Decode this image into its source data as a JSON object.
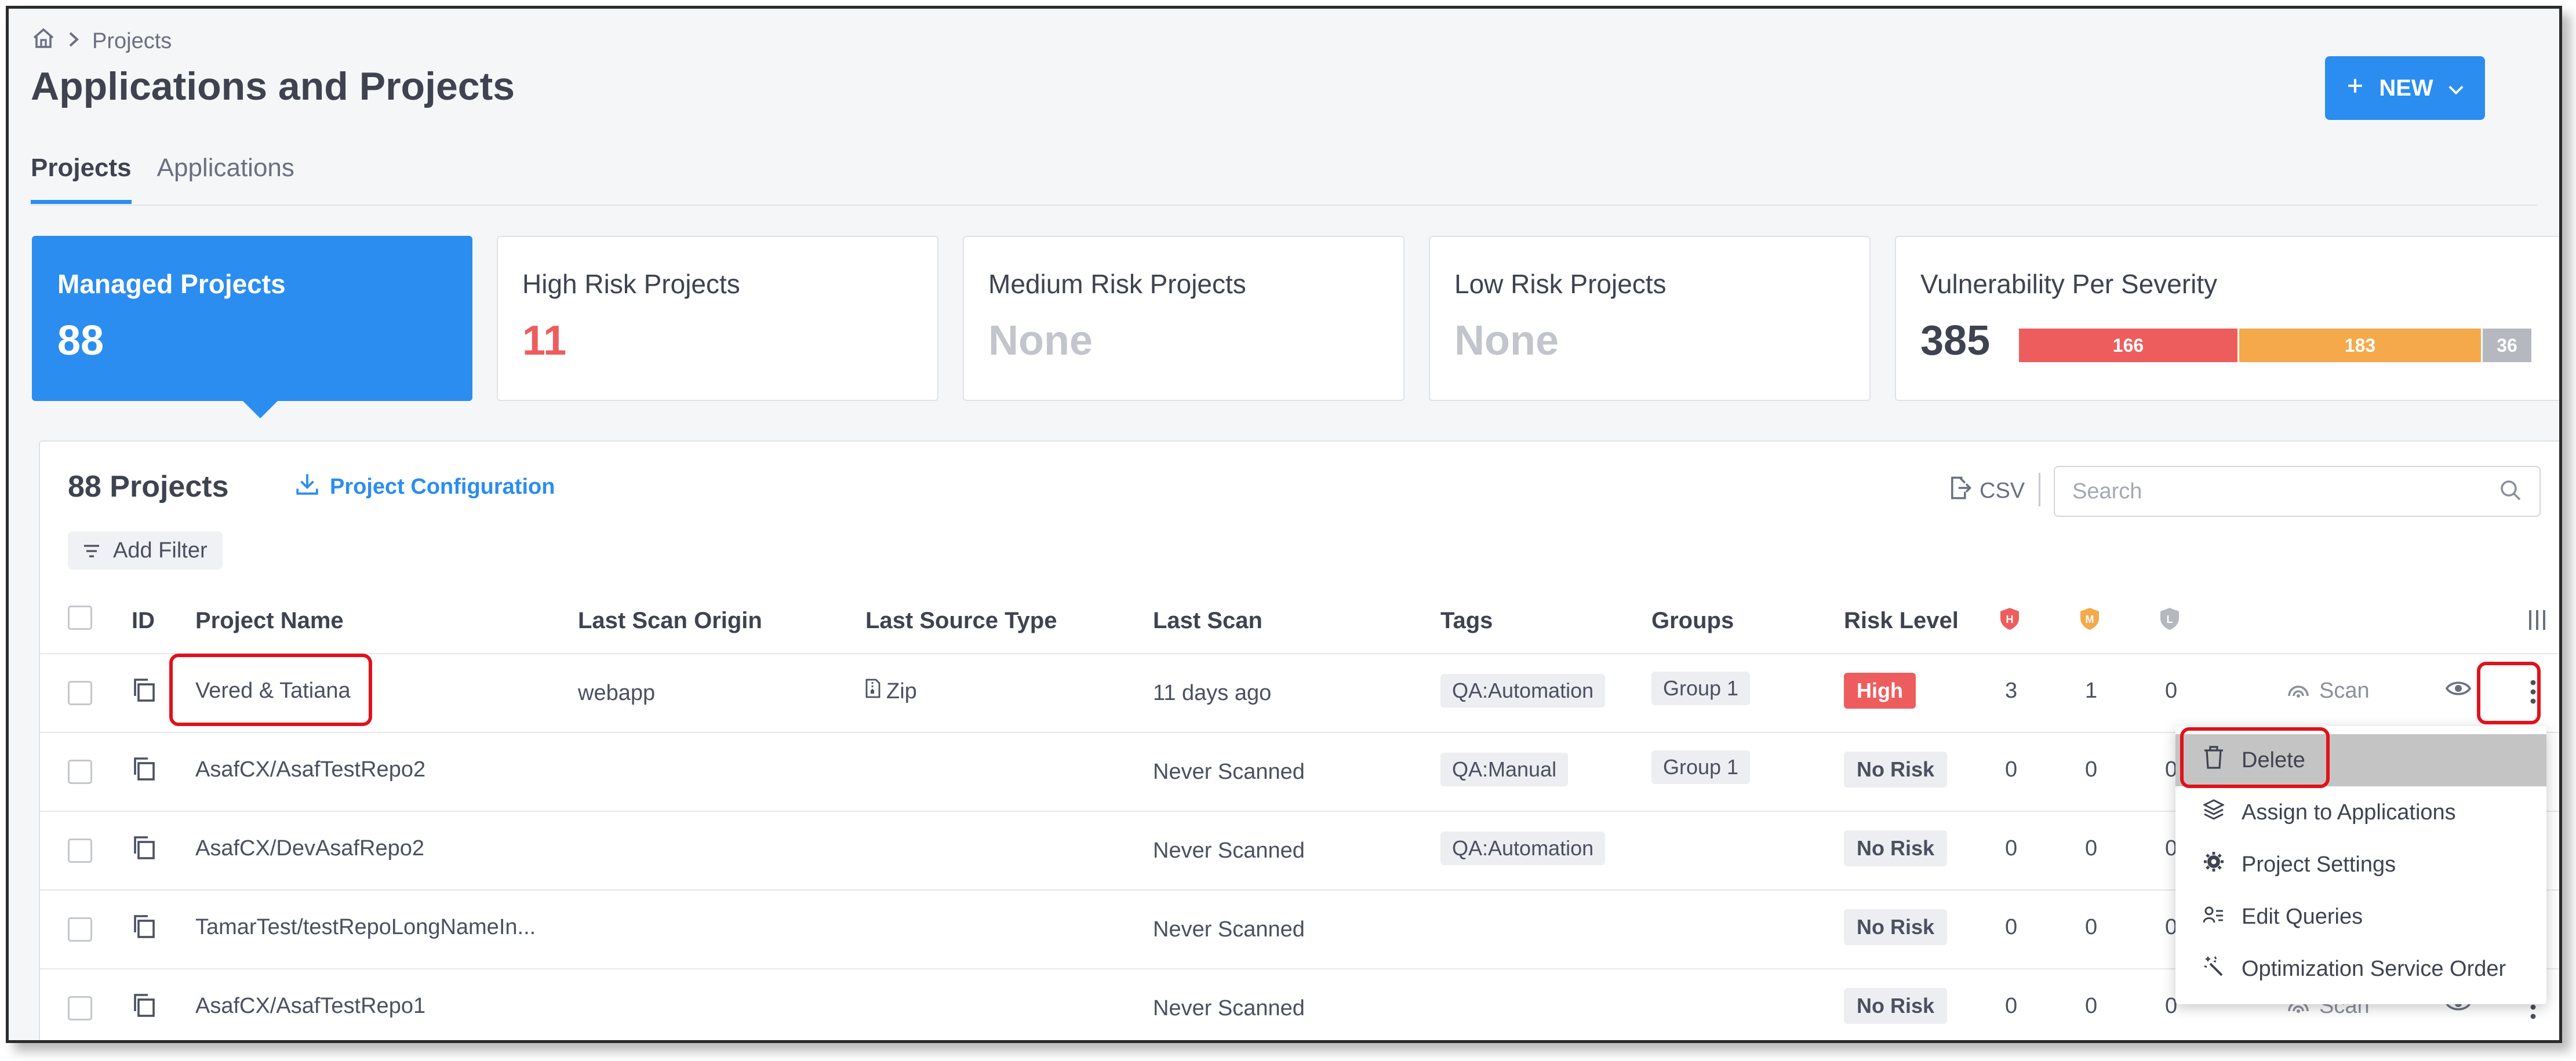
{
  "breadcrumb": {
    "current": "Projects"
  },
  "page": {
    "title": "Applications and Projects"
  },
  "new_button": {
    "label": "NEW"
  },
  "tabs": [
    {
      "label": "Projects"
    },
    {
      "label": "Applications"
    }
  ],
  "cards": {
    "managed": {
      "label": "Managed Projects",
      "value": "88"
    },
    "high": {
      "label": "High Risk Projects",
      "value": "11"
    },
    "medium": {
      "label": "Medium Risk Projects",
      "value": "None"
    },
    "low": {
      "label": "Low Risk Projects",
      "value": "None"
    },
    "severity": {
      "label": "Vulnerability Per Severity",
      "total": "385",
      "high": "166",
      "medium": "183",
      "low": "36"
    }
  },
  "colors": {
    "accent": "#2b8df0",
    "high": "#ee5d5d",
    "medium": "#f5a94a",
    "low": "#b5b8bf",
    "highlight": "#e0121b"
  },
  "table": {
    "count": "88 Projects",
    "config_link": "Project Configuration",
    "csv_label": "CSV",
    "search_placeholder": "Search",
    "add_filter": "Add Filter",
    "headers": {
      "id": "ID",
      "name": "Project Name",
      "origin": "Last Scan Origin",
      "source": "Last Source Type",
      "scan": "Last Scan",
      "tags": "Tags",
      "groups": "Groups",
      "risk": "Risk Level"
    },
    "scan_label": "Scan",
    "rows": [
      {
        "name": "Vered & Tatiana",
        "origin": "webapp",
        "source": "Zip",
        "scan": "11 days ago",
        "tag": "QA:Automation",
        "group": "Group 1",
        "risk": "High",
        "h": "3",
        "m": "1",
        "l": "0"
      },
      {
        "name": "AsafCX/AsafTestRepo2",
        "origin": "",
        "source": "",
        "scan": "Never Scanned",
        "tag": "QA:Manual",
        "group": "Group 1",
        "risk": "No Risk",
        "h": "0",
        "m": "0",
        "l": "0"
      },
      {
        "name": "AsafCX/DevAsafRepo2",
        "origin": "",
        "source": "",
        "scan": "Never Scanned",
        "tag": "QA:Automation",
        "group": "",
        "risk": "No Risk",
        "h": "0",
        "m": "0",
        "l": "0"
      },
      {
        "name": "TamarTest/testRepoLongNameIn...",
        "origin": "",
        "source": "",
        "scan": "Never Scanned",
        "tag": "",
        "group": "",
        "risk": "No Risk",
        "h": "0",
        "m": "0",
        "l": "0"
      },
      {
        "name": "AsafCX/AsafTestRepo1",
        "origin": "",
        "source": "",
        "scan": "Never Scanned",
        "tag": "",
        "group": "",
        "risk": "No Risk",
        "h": "0",
        "m": "0",
        "l": "0"
      }
    ]
  },
  "menu": {
    "items": [
      {
        "label": "Delete",
        "icon": "trash-icon"
      },
      {
        "label": "Assign to Applications",
        "icon": "layers-icon"
      },
      {
        "label": "Project Settings",
        "icon": "gear-icon"
      },
      {
        "label": "Edit Queries",
        "icon": "edit-queries-icon"
      },
      {
        "label": "Optimization Service Order",
        "icon": "magic-wand-icon"
      }
    ]
  }
}
